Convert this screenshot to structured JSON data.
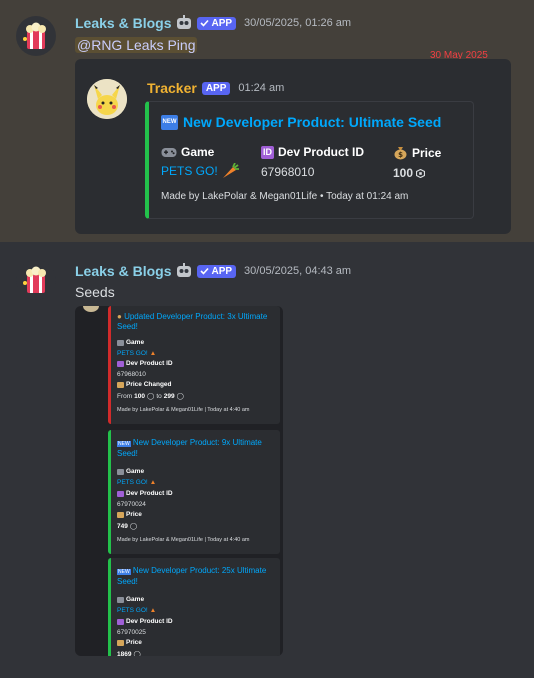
{
  "message1": {
    "username": "Leaks & Blogs",
    "app_badge": "APP",
    "timestamp": "30/05/2025, 01:26 am",
    "mention": "@RNG Leaks Ping",
    "date_divider": "30 May 2025",
    "forward": {
      "author": "Tracker",
      "app_badge": "APP",
      "time": "01:24 am",
      "embed": {
        "title": "New Developer Product: Ultimate Seed",
        "new_icon": "NEW",
        "fields": [
          {
            "name": "Game",
            "value": "PETS GO!"
          },
          {
            "name": "Dev Product ID",
            "value": "67968010",
            "icon": "ID"
          },
          {
            "name": "Price",
            "value": "100"
          }
        ],
        "footer": "Made by LakePolar & Megan01Life • Today at 01:24 am"
      }
    }
  },
  "message2": {
    "username": "Leaks & Blogs",
    "app_badge": "APP",
    "timestamp": "30/05/2025, 04:43 am",
    "text": "Seeds",
    "screenshot": {
      "embeds": [
        {
          "title": "Updated Developer Product: 3x Ultimate Seed!",
          "game_label": "Game",
          "game_value": "PETS GO!",
          "id_label": "Dev Product ID",
          "id_value": "67968010",
          "price_label": "Price Changed",
          "price_from": "From",
          "price_old": "100",
          "price_to": "to",
          "price_new": "299",
          "footer": "Made by LakePolar & Megan01Life | Today at 4:40 am"
        },
        {
          "title": "New Developer Product: 9x Ultimate Seed!",
          "game_label": "Game",
          "game_value": "PETS GO!",
          "id_label": "Dev Product ID",
          "id_value": "67970024",
          "price_label": "Price",
          "price_value": "749",
          "footer": "Made by LakePolar & Megan01Life | Today at 4:40 am"
        },
        {
          "title": "New Developer Product: 25x Ultimate Seed!",
          "game_label": "Game",
          "game_value": "PETS GO!",
          "id_label": "Dev Product ID",
          "id_value": "67970025",
          "price_label": "Price",
          "price_value": "1869"
        }
      ]
    }
  },
  "icons": {
    "verified": "checkmark-icon",
    "game": "gamepad-icon",
    "price": "moneybag-icon",
    "robux": "robux-icon",
    "carrot": "carrot-icon",
    "robot": "robot-icon"
  },
  "colors": {
    "accent": "#5865f2",
    "embed_green": "#23c14b",
    "embed_red": "#d12b2b",
    "link": "#00a8fc",
    "username": "#8ad0e8",
    "tracker_name": "#f0b232"
  }
}
